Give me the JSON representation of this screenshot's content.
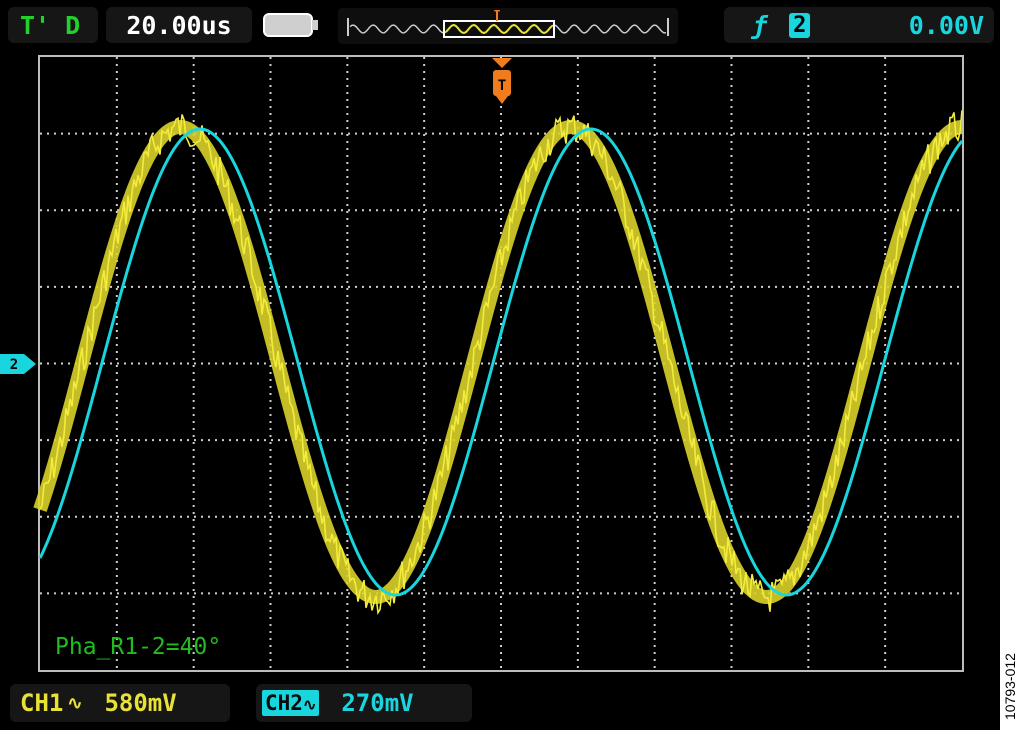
{
  "header": {
    "trigger_mode": "T' D",
    "timebase": "20.00us",
    "trigger_slope_icon": "rising-edge-icon",
    "trigger_source": "2",
    "trigger_level": "0.00V",
    "memory_marker": "T"
  },
  "display": {
    "phase_readout": "Pha_R1-2=40°",
    "ch_level_marker": "2",
    "trigger_marker": "T"
  },
  "channels": {
    "ch1": {
      "label": "CH1",
      "coupling_icon": "ac-coupling-icon",
      "volts_div": "580mV",
      "color": "#e8e236"
    },
    "ch2": {
      "label": "CH2",
      "coupling_icon": "ac-coupling-icon",
      "volts_div": "270mV",
      "color": "#19d6de"
    }
  },
  "figure_code": "10793-012",
  "colors": {
    "grid": "#cfcfcf",
    "background": "#000000",
    "trigger": "#f07c1e",
    "label_green": "#22d12a"
  }
}
